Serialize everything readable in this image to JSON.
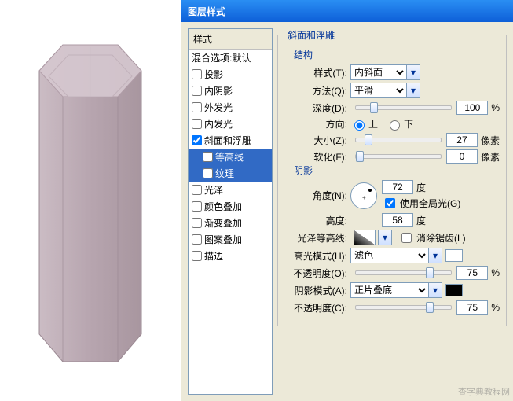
{
  "title": "图层样式",
  "sidebar": {
    "header": "样式",
    "blend": "混合选项:默认",
    "items": [
      {
        "label": "投影",
        "checked": false
      },
      {
        "label": "内阴影",
        "checked": false
      },
      {
        "label": "外发光",
        "checked": false
      },
      {
        "label": "内发光",
        "checked": false
      },
      {
        "label": "斜面和浮雕",
        "checked": true,
        "selected": false
      },
      {
        "label": "等高线",
        "checked": false,
        "sub": true,
        "selected": true
      },
      {
        "label": "纹理",
        "checked": false,
        "sub": true,
        "selected": true
      },
      {
        "label": "光泽",
        "checked": false
      },
      {
        "label": "颜色叠加",
        "checked": false
      },
      {
        "label": "渐变叠加",
        "checked": false
      },
      {
        "label": "图案叠加",
        "checked": false
      },
      {
        "label": "描边",
        "checked": false
      }
    ]
  },
  "panel_title": "斜面和浮雕",
  "structure": {
    "legend": "结构",
    "style_label": "样式(T):",
    "style_value": "内斜面",
    "method_label": "方法(Q):",
    "method_value": "平滑",
    "depth_label": "深度(D):",
    "depth_value": "100",
    "depth_unit": "%",
    "direction_label": "方向:",
    "dir_up": "上",
    "dir_down": "下",
    "size_label": "大小(Z):",
    "size_value": "27",
    "size_unit": "像素",
    "soften_label": "软化(F):",
    "soften_value": "0",
    "soften_unit": "像素"
  },
  "shading": {
    "legend": "阴影",
    "angle_label": "角度(N):",
    "angle_value": "72",
    "angle_unit": "度",
    "global_light": "使用全局光(G)",
    "altitude_label": "高度:",
    "altitude_value": "58",
    "altitude_unit": "度",
    "gloss_label": "光泽等高线:",
    "antialias": "消除锯齿(L)",
    "highlight_mode_label": "高光模式(H):",
    "highlight_mode_value": "滤色",
    "highlight_opacity_label": "不透明度(O):",
    "highlight_opacity_value": "75",
    "highlight_opacity_unit": "%",
    "shadow_mode_label": "阴影模式(A):",
    "shadow_mode_value": "正片叠底",
    "shadow_opacity_label": "不透明度(C):",
    "shadow_opacity_value": "75",
    "shadow_opacity_unit": "%"
  },
  "colors": {
    "highlight": "#ffffff",
    "shadow": "#000000"
  },
  "watermark": "查字典教程网"
}
